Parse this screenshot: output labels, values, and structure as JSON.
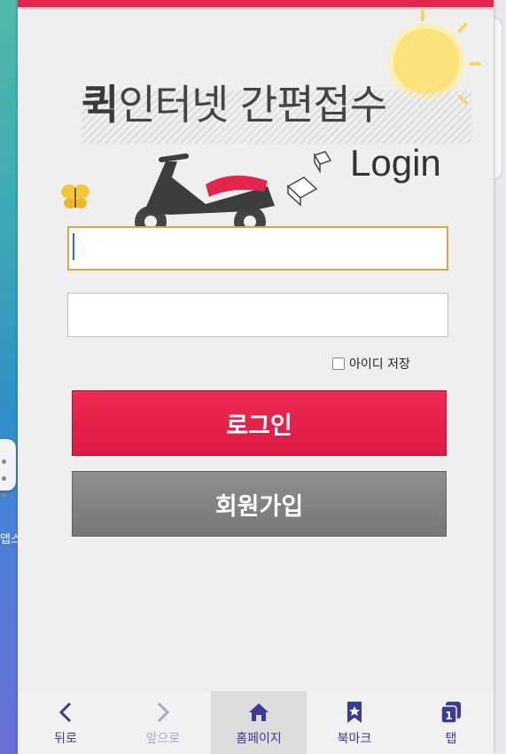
{
  "hero": {
    "title_strong": "퀵",
    "title_rest": "인터넷 간편접수",
    "login_word": "Login"
  },
  "form": {
    "id_value": "",
    "pw_value": "",
    "remember_label": "아이디 저장",
    "login_button": "로그인",
    "signup_button": "회원가입"
  },
  "background": {
    "apps_label": "앱스"
  },
  "bottom_nav": {
    "back": "뒤로",
    "forward": "앞으로",
    "home": "홈페이지",
    "bookmark": "북마크",
    "tabs": "탭",
    "tab_count": "1"
  },
  "colors": {
    "accent": "#e2264d",
    "nav_text": "#3b3b8f",
    "signup_gray": "#808080",
    "focus_border": "#d6a742"
  }
}
